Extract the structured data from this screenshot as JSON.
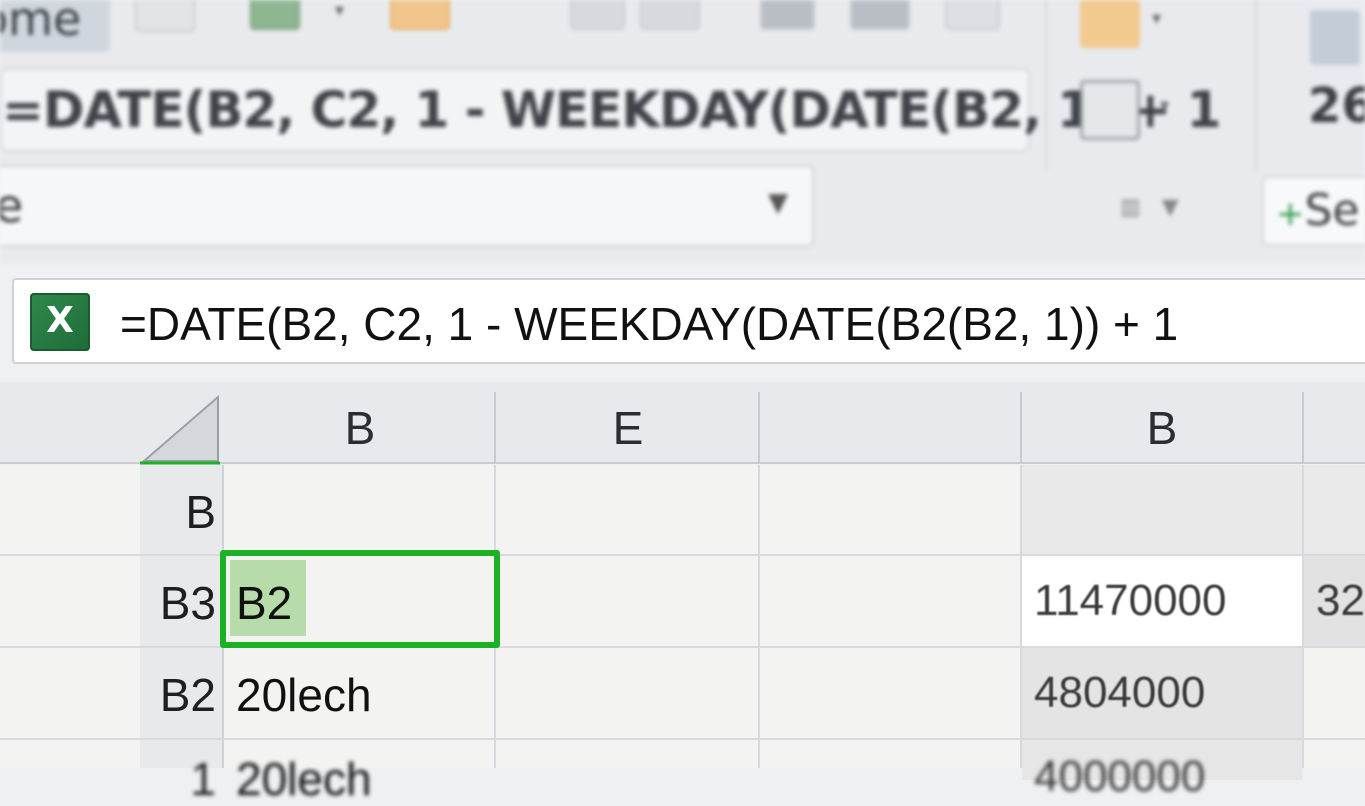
{
  "ribbon": {
    "home_tab": "ome",
    "formula_preview": "=DATE(B2, C2, 1  -  WEEKDAY(DATE(B2, 1) + 1",
    "name_box": "le",
    "zoom_value": "26",
    "select_button": "Se"
  },
  "formula_bar": {
    "app_icon": "X",
    "formula": "=DATE(B2, C2, 1  -  WEEKDAY(DATE(B2(B2, 1)) + 1"
  },
  "columns": [
    "B",
    "E",
    "",
    "B"
  ],
  "rows": [
    {
      "header": "B",
      "cells": [
        "",
        "",
        ""
      ]
    },
    {
      "header": "B3",
      "cells": [
        "B2",
        "",
        ""
      ]
    },
    {
      "header": "B2",
      "cells": [
        "20lech",
        "",
        ""
      ]
    },
    {
      "header": "1",
      "cells": [
        "20lech",
        "",
        ""
      ]
    }
  ],
  "right_values": [
    "11470000",
    "4804000",
    "4000000"
  ],
  "right_edge_values": [
    "32"
  ],
  "selected_cell": "B2",
  "colors": {
    "selection_border": "#1cb024",
    "selection_fill": "#b7dba9",
    "excel_green": "#217346"
  },
  "icons": [
    "excel-icon",
    "paste-icon",
    "format-painter-icon",
    "dropdown-caret-icon"
  ]
}
